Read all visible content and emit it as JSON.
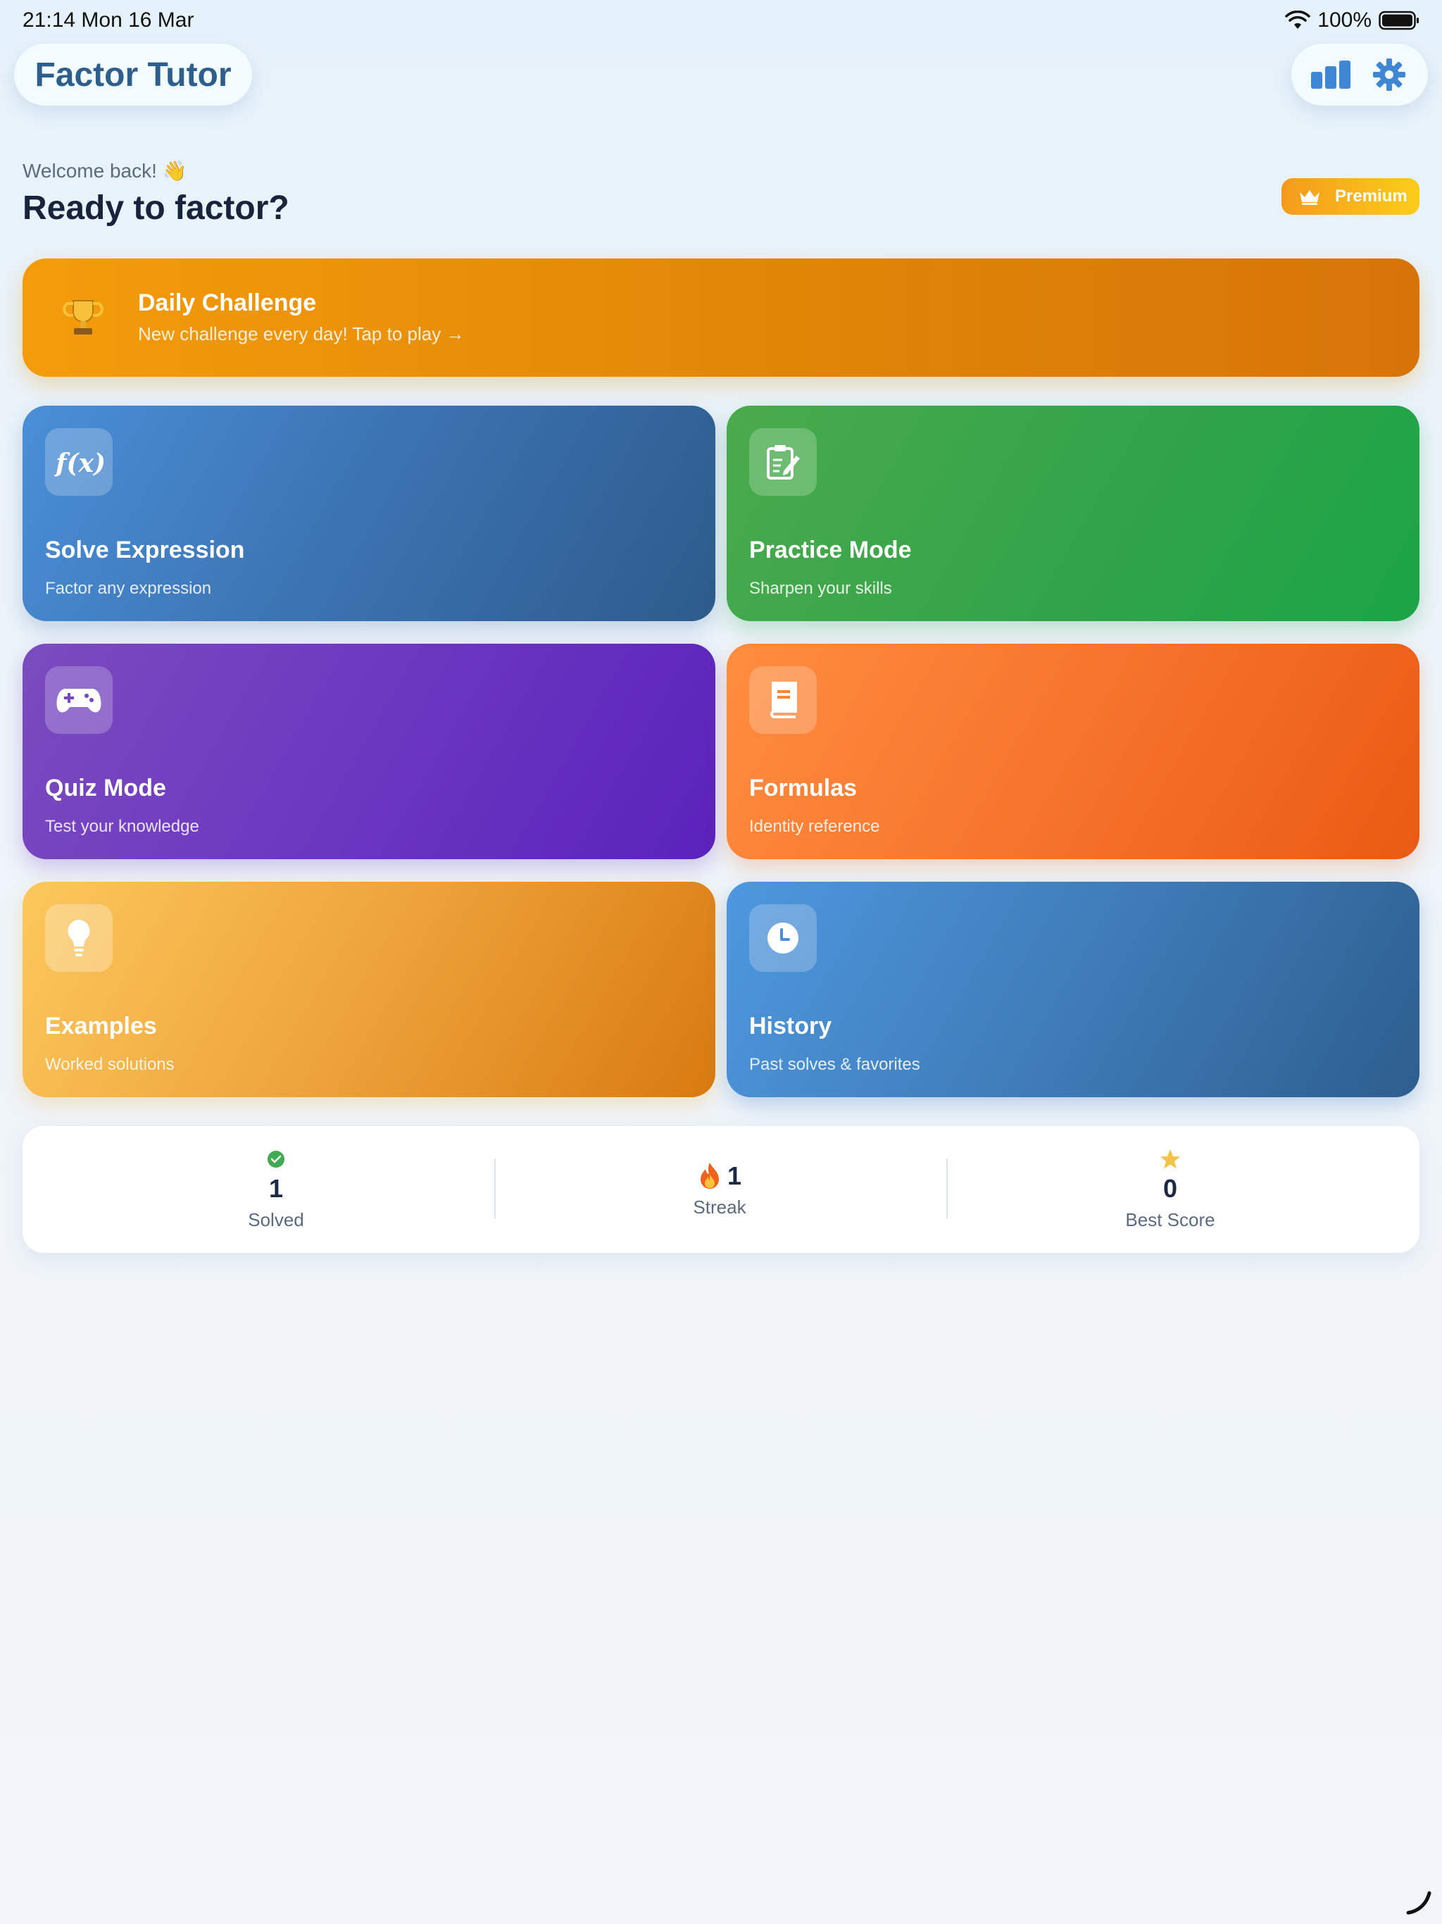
{
  "status_bar": {
    "time": "21:14   Mon 16 Mar",
    "battery": "100%"
  },
  "header": {
    "title": "Factor Tutor",
    "actions": [
      {
        "icon": "bar-chart-icon"
      },
      {
        "icon": "gear-icon"
      }
    ]
  },
  "greeting": {
    "welcome": "Welcome back! 👋",
    "headline": "Ready to factor?"
  },
  "premium": {
    "label": "Premium",
    "icon": "crown-icon"
  },
  "daily_challenge": {
    "title": "Daily Challenge",
    "subtitle": "New challenge every day! Tap to play →",
    "icon": "trophy-icon"
  },
  "cards": [
    {
      "id": "solve",
      "title": "Solve Expression",
      "subtitle": "Factor any expression",
      "icon": "function-icon"
    },
    {
      "id": "practice",
      "title": "Practice Mode",
      "subtitle": "Sharpen your skills",
      "icon": "clipboard-edit-icon"
    },
    {
      "id": "quiz",
      "title": "Quiz Mode",
      "subtitle": "Test your knowledge",
      "icon": "gamepad-icon"
    },
    {
      "id": "formulas",
      "title": "Formulas",
      "subtitle": "Identity reference",
      "icon": "book-icon"
    },
    {
      "id": "examples",
      "title": "Examples",
      "subtitle": "Worked solutions",
      "icon": "lightbulb-icon"
    },
    {
      "id": "history",
      "title": "History",
      "subtitle": "Past solves & favorites",
      "icon": "clock-icon"
    }
  ],
  "stats": [
    {
      "value": "1",
      "label": "Solved",
      "icon": "check-circle-icon"
    },
    {
      "value": "1",
      "label": "Streak",
      "icon": "fire-icon"
    },
    {
      "value": "0",
      "label": "Best Score",
      "icon": "star-icon"
    }
  ],
  "colors": {
    "accent": "#2e5e8c",
    "daily": "#f39c0b",
    "solve": "#3b72b0",
    "practice": "#32a34a",
    "quiz": "#6a35c0",
    "formulas": "#f5712b",
    "examples": "#eda23a",
    "history": "#3f7cb9"
  }
}
